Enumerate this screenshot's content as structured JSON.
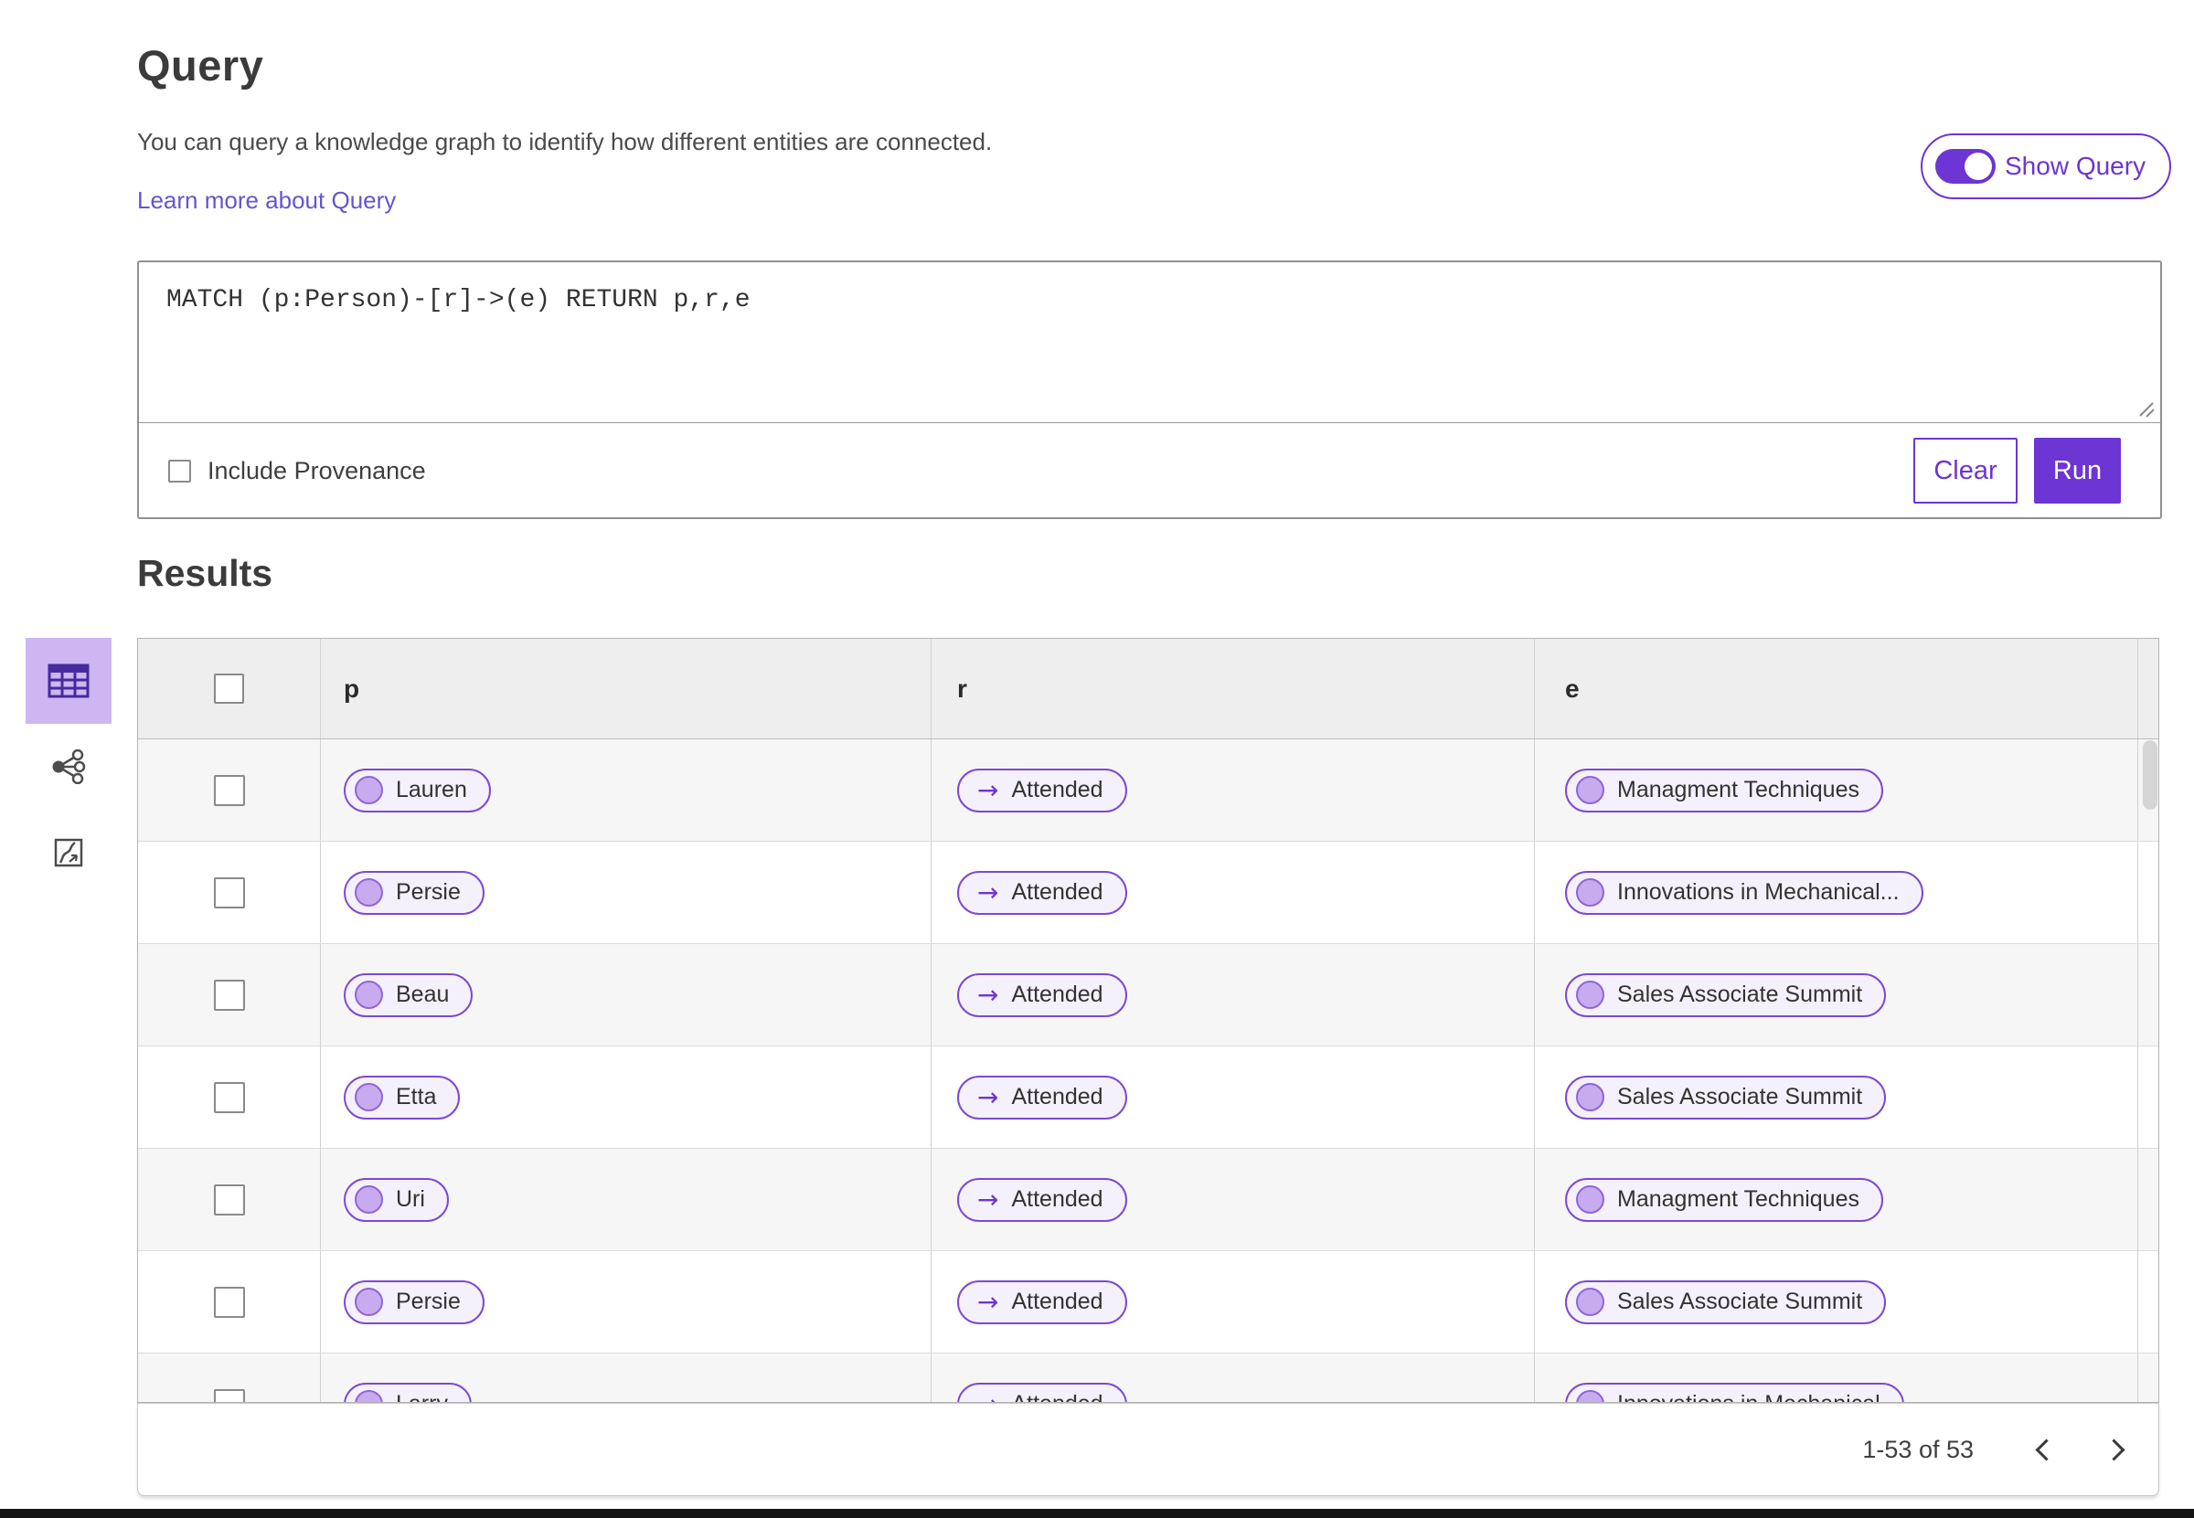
{
  "header": {
    "title": "Query",
    "description": "You can query a knowledge graph to identify how different entities are connected.",
    "learn_more_label": "Learn more about Query",
    "show_query": {
      "label": "Show Query",
      "state": "on"
    }
  },
  "query_editor": {
    "value": "MATCH (p:Person)-[r]->(e) RETURN p,r,e",
    "include_provenance": {
      "label": "Include Provenance",
      "checked": false
    },
    "clear_label": "Clear",
    "run_label": "Run"
  },
  "results": {
    "title": "Results",
    "view_switcher": [
      {
        "icon": "table-view-icon",
        "selected": true
      },
      {
        "icon": "network-view-icon",
        "selected": false
      },
      {
        "icon": "chart-view-icon",
        "selected": false
      }
    ],
    "table": {
      "columns": [
        "p",
        "r",
        "e"
      ],
      "arrow_glyph": "→",
      "rows": [
        {
          "p": "Lauren",
          "r": "Attended",
          "e": "Managment Techniques"
        },
        {
          "p": "Persie",
          "r": "Attended",
          "e": "Innovations in Mechanical..."
        },
        {
          "p": "Beau",
          "r": "Attended",
          "e": "Sales Associate Summit"
        },
        {
          "p": "Etta",
          "r": "Attended",
          "e": "Sales Associate Summit"
        },
        {
          "p": "Uri",
          "r": "Attended",
          "e": "Managment Techniques"
        },
        {
          "p": "Persie",
          "r": "Attended",
          "e": "Sales Associate Summit"
        },
        {
          "p": "Larry",
          "r": "Attended",
          "e": "Innovations in Mechanical"
        }
      ]
    },
    "pagination": {
      "range_label": "1-53 of 53"
    }
  },
  "colors": {
    "accent_purple": "#6C35D4",
    "pill_border": "#7b4ad2",
    "pill_background": "#f5f1fc",
    "node_circle": "#c7abee",
    "selected_tile": "#cdb6f1",
    "link": "#6355cf",
    "table_header_bg": "#eeeeee",
    "row_alt_bg": "#f6f6f6"
  }
}
